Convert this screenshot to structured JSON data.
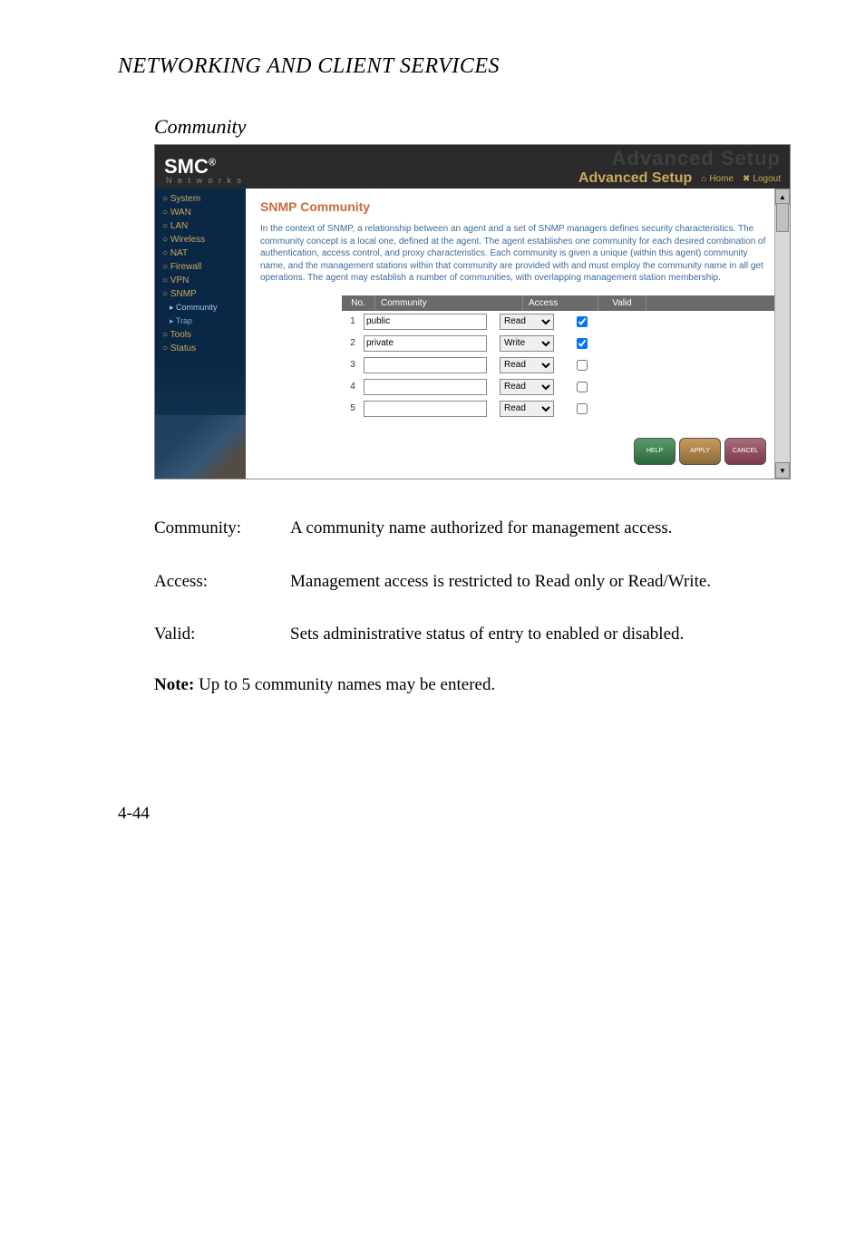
{
  "doc": {
    "header": "NETWORKING AND CLIENT SERVICES",
    "section": "Community",
    "page_number": "4-44"
  },
  "app": {
    "logo": "SMC",
    "logo_reg": "®",
    "logo_sub": "N e t w o r k s",
    "ghost": "Advanced Setup",
    "setup_title": "Advanced Setup",
    "home": "Home",
    "logout": "Logout"
  },
  "sidebar": [
    {
      "label": "System",
      "type": "top"
    },
    {
      "label": "WAN",
      "type": "top"
    },
    {
      "label": "LAN",
      "type": "top"
    },
    {
      "label": "Wireless",
      "type": "top"
    },
    {
      "label": "NAT",
      "type": "top"
    },
    {
      "label": "Firewall",
      "type": "top"
    },
    {
      "label": "VPN",
      "type": "top"
    },
    {
      "label": "SNMP",
      "type": "top"
    },
    {
      "label": "Community",
      "type": "sub",
      "active": true
    },
    {
      "label": "Trap",
      "type": "sub"
    },
    {
      "label": "Tools",
      "type": "top"
    },
    {
      "label": "Status",
      "type": "top"
    }
  ],
  "content": {
    "title": "SNMP Community",
    "paragraph": "In the context of SNMP, a relationship between an agent and a set of SNMP managers defines security characteristics. The community concept is a local one, defined at the agent. The agent establishes one community for each desired combination of authentication, access control, and proxy characteristics. Each community is given a unique (within this agent) community name, and the management stations within that community are provided with and must employ the community name in all get operations. The agent may establish a number of communities, with overlapping management station membership."
  },
  "table": {
    "headers": {
      "no": "No.",
      "community": "Community",
      "access": "Access",
      "valid": "Valid"
    },
    "rows": [
      {
        "no": "1",
        "community": "public",
        "access": "Read",
        "valid": true
      },
      {
        "no": "2",
        "community": "private",
        "access": "Write",
        "valid": true
      },
      {
        "no": "3",
        "community": "",
        "access": "Read",
        "valid": false
      },
      {
        "no": "4",
        "community": "",
        "access": "Read",
        "valid": false
      },
      {
        "no": "5",
        "community": "",
        "access": "Read",
        "valid": false
      }
    ]
  },
  "buttons": {
    "help": "HELP",
    "apply": "APPLY",
    "cancel": "CANCEL"
  },
  "definitions": [
    {
      "term": "Community:",
      "desc": "A community name authorized for management access."
    },
    {
      "term": "Access:",
      "desc": "Management access is restricted to Read only or Read/Write."
    },
    {
      "term": "Valid:",
      "desc": "Sets administrative status of entry to enabled or disabled."
    }
  ],
  "note": {
    "label": "Note:",
    "text": "Up to 5 community names may be entered."
  }
}
